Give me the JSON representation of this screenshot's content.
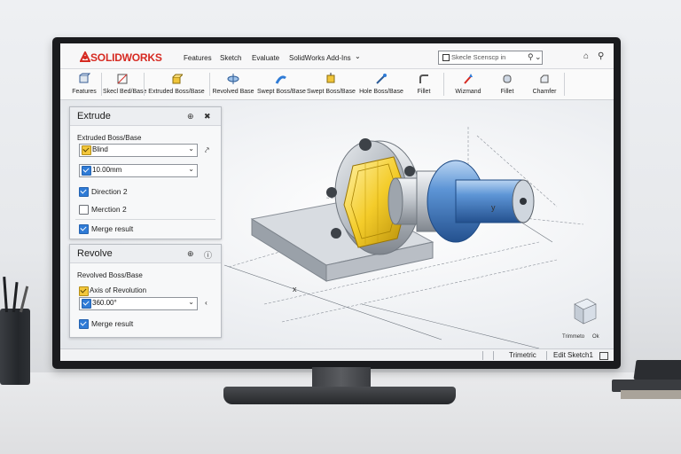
{
  "app": {
    "logo_text": "SOLIDWORKS",
    "brand_color": "#d62a22",
    "menu": [
      "Features",
      "Sketch",
      "Evaluate",
      "SolidWorks Add-Ins"
    ],
    "menu_more_icon": "chevron-down-icon",
    "search_placeholder": "Skecle Scenscp in",
    "titlebar_icons": [
      "home-icon",
      "pin-icon"
    ]
  },
  "ribbon": {
    "items": [
      {
        "label": "Features",
        "icon": "features-icon"
      },
      {
        "label": "Skecl Bed/Base",
        "icon": "sketch-icon"
      },
      {
        "label": "Extruded Boss/Base",
        "icon": "extrude-icon"
      },
      {
        "label": "Revolved Base",
        "icon": "revolve-icon"
      },
      {
        "label": "Swept Boss/Base",
        "icon": "swept-icon"
      },
      {
        "label": "Swept Boss/Base",
        "icon": "swept-boss-icon"
      },
      {
        "label": "Hole Boss/Base",
        "icon": "hole-icon"
      },
      {
        "label": "Fillet",
        "icon": "fillet-icon"
      },
      {
        "label": "Wizmand",
        "icon": "wizard-icon"
      },
      {
        "label": "Fillet",
        "icon": "fillet2-icon"
      },
      {
        "label": "Chamfer",
        "icon": "chamfer-icon"
      }
    ]
  },
  "extrude_panel": {
    "title": "Extrude",
    "subtitle": "Extruded Boss/Base",
    "end_condition": "Blind",
    "depth": "10.00mm",
    "options": [
      {
        "label": "Direction 2",
        "checked": true
      },
      {
        "label": "Merction 2",
        "checked": false
      },
      {
        "label": "Merge result",
        "checked": true
      }
    ]
  },
  "revolve_panel": {
    "title": "Revolve",
    "subtitle": "Revolved Boss/Base",
    "axis_label": "Axis of Revolution",
    "angle": "360.00°",
    "merge_label": "Merge result",
    "merge_checked": true
  },
  "viewport": {
    "axis_labels": {
      "x": "x",
      "y": "y",
      "z": "z",
      "x2": "X",
      "y2": "y"
    },
    "viewcube_labels": [
      "Trimmeto",
      "Ok"
    ]
  },
  "status_bar": {
    "view": "Trimetric",
    "mode": "Edit Sketch1"
  }
}
